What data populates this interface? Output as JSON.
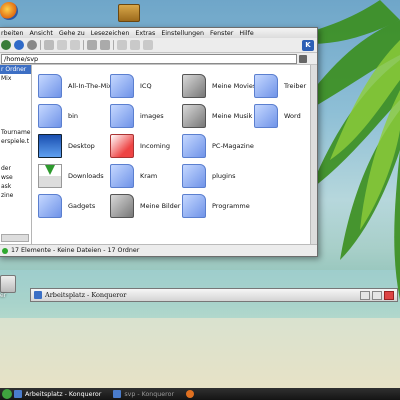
{
  "desktop": {
    "top_icon_label": "",
    "left_icon_label": "er"
  },
  "window": {
    "menu": [
      "rbeiten",
      "Ansicht",
      "Gehe zu",
      "Lesezeichen",
      "Extras",
      "Einstellungen",
      "Fenster",
      "Hilfe"
    ],
    "location": "/home/svp",
    "sidebar_items": [
      "r Ordner",
      "Mix",
      "",
      "",
      "",
      "",
      "",
      "Tournamer",
      "erspiele.t",
      "",
      "",
      "der",
      "wse",
      "ask",
      "zine",
      "",
      ""
    ],
    "files": [
      {
        "name": "All-In-The-Mix",
        "icon": "folder-icon"
      },
      {
        "name": "ICQ",
        "icon": "folder-icon"
      },
      {
        "name": "Meine Movies",
        "icon": "special-folder-icon"
      },
      {
        "name": "Treiber",
        "icon": "folder-icon"
      },
      {
        "name": "bin",
        "icon": "folder-icon"
      },
      {
        "name": "images",
        "icon": "folder-icon"
      },
      {
        "name": "Meine Musik",
        "icon": "special-folder-icon"
      },
      {
        "name": "Word",
        "icon": "folder-icon"
      },
      {
        "name": "Desktop",
        "icon": "desktop-folder-icon"
      },
      {
        "name": "Incoming",
        "icon": "incoming-folder-icon"
      },
      {
        "name": "PC-Magazine",
        "icon": "folder-icon"
      },
      {
        "name": "",
        "icon": ""
      },
      {
        "name": "Downloads",
        "icon": "downloads-folder-icon"
      },
      {
        "name": "Kram",
        "icon": "folder-icon"
      },
      {
        "name": "plugins",
        "icon": "folder-icon"
      },
      {
        "name": "",
        "icon": ""
      },
      {
        "name": "Gadgets",
        "icon": "folder-icon"
      },
      {
        "name": "Meine Bilder",
        "icon": "special-folder-icon"
      },
      {
        "name": "Programme",
        "icon": "folder-icon"
      },
      {
        "name": "",
        "icon": ""
      }
    ],
    "status": "17 Elemente - Keine Dateien - 17 Ordner"
  },
  "second_window": {
    "title": "Arbeitsplatz - Konqueror"
  },
  "taskbar": {
    "tasks": [
      {
        "label": "Arbeitsplatz - Konqueror",
        "active": true
      },
      {
        "label": "svp - Konqueror",
        "active": false
      },
      {
        "label": "",
        "active": false
      }
    ]
  }
}
